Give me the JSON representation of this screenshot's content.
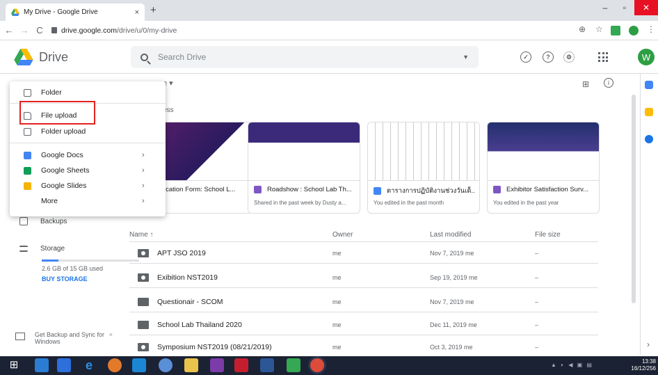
{
  "browser": {
    "tab_title": "My Drive - Google Drive",
    "tab_close": "×",
    "new_tab": "+",
    "url_host": "drive.google.com",
    "url_path": "/drive/u/0/my-drive",
    "window_min": "–",
    "window_max": "▫",
    "window_close": "✕"
  },
  "header": {
    "app_name": "Drive",
    "search_placeholder": "Search Drive",
    "avatar_letter": "W"
  },
  "new_menu": {
    "items": [
      {
        "label": "Folder"
      },
      {
        "label": "File upload"
      },
      {
        "label": "Folder upload"
      },
      {
        "label": "Google Docs",
        "arrow": "›"
      },
      {
        "label": "Google Sheets",
        "arrow": "›"
      },
      {
        "label": "Google Slides",
        "arrow": "›"
      },
      {
        "label": "More",
        "arrow": "›"
      }
    ]
  },
  "sidebar": {
    "backups": "Backups",
    "storage": "Storage",
    "storage_used": "2.6 GB of 15 GB used",
    "storage_fraction": 0.17,
    "buy_storage": "BUY STORAGE",
    "backup_sync": "Get Backup and Sync for Windows"
  },
  "main": {
    "quick_access_label": "ess",
    "cards": [
      {
        "title": "ication Form: School L...",
        "sub": "today"
      },
      {
        "title": "Roadshow : School Lab Th...",
        "sub": "Shared in the past week by Dusty a..."
      },
      {
        "title": "ตารางการปฏิบัติงานช่วงวันเด็...",
        "sub": "You edited in the past month"
      },
      {
        "title": "Exhibitor Satisfaction Surv...",
        "sub": "You edited in the past year"
      }
    ],
    "columns": {
      "name": "Name ↑",
      "owner": "Owner",
      "last_modified": "Last modified",
      "file_size": "File size"
    },
    "rows": [
      {
        "name": "APT JSO 2019",
        "owner": "me",
        "modified": "Nov 7, 2019 me",
        "size": "–"
      },
      {
        "name": "Exibition NST2019",
        "owner": "me",
        "modified": "Sep 19, 2019 me",
        "size": "–"
      },
      {
        "name": "Questionair - SCOM",
        "owner": "me",
        "modified": "Nov 7, 2019 me",
        "size": "–"
      },
      {
        "name": "School Lab Thailand 2020",
        "owner": "me",
        "modified": "Dec 11, 2019 me",
        "size": "–"
      },
      {
        "name": "Symposium NST2019 (08/21/2019)",
        "owner": "me",
        "modified": "Oct 3, 2019 me",
        "size": "–"
      }
    ]
  },
  "taskbar": {
    "time": "13:38",
    "date": "16/12/256"
  }
}
